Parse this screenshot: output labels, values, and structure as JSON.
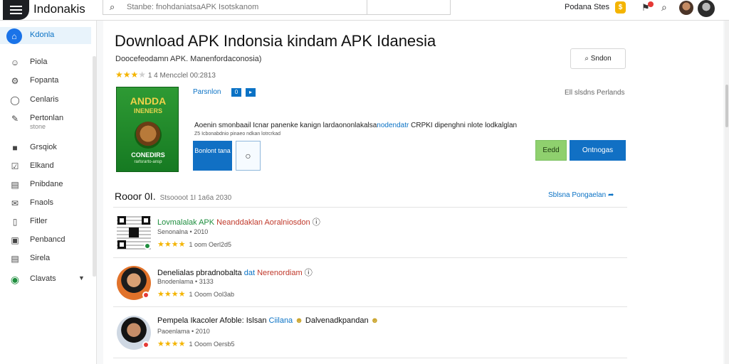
{
  "header": {
    "brand": "Indonakis",
    "search_placeholder": "Stanbe: fnohdaniatsaAPK Isotskanom",
    "user_label": "Podana Stes",
    "coin_label": "$",
    "icons": [
      "menu-icon",
      "search-icon",
      "notification-icon",
      "avatar"
    ]
  },
  "sidebar": {
    "items": [
      {
        "label": "Kdonla",
        "icon": "home-icon",
        "active": true
      },
      {
        "label": "Piola",
        "icon": "people-icon"
      },
      {
        "label": "Fopanta",
        "icon": "puzzle-icon"
      },
      {
        "label": "Cenlaris",
        "icon": "globe-icon"
      },
      {
        "label": "Pertonlan",
        "sub": "stone",
        "icon": "pen-icon"
      },
      {
        "label": "Grsqiok",
        "icon": "briefcase-icon"
      },
      {
        "label": "Elkand",
        "icon": "checkbox-icon"
      },
      {
        "label": "Pnibdane",
        "icon": "folder-icon"
      },
      {
        "label": "Fnaols",
        "icon": "mail-icon"
      },
      {
        "label": "Fitler",
        "icon": "chart-icon"
      },
      {
        "label": "Penbancd",
        "icon": "window-icon"
      },
      {
        "label": "Sirela",
        "icon": "document-icon"
      },
      {
        "label": "Clavats",
        "icon": "green-circle-icon"
      }
    ]
  },
  "main": {
    "title": "Download APK Indonsia kindam APK Idanesia",
    "subtitle": "Doocefeodamn APK. Manenfordaconosia)",
    "rating_text": "1 4 Mencclel 00:2813",
    "stars": 3,
    "top_button": "Sndon",
    "app": {
      "icon_line1": "ANDDA",
      "icon_line2": "INENERS",
      "icon_line3": "CONEDIRS",
      "icon_line4": "rarlsrarto-ansp",
      "developer": "Parsnlon",
      "meta_right": "Ell slsdns Perlands",
      "description_before": "Aoenin smonbaail Icnar panenke kanign lardaononlakalsa",
      "description_highlight": "nodendatr",
      "description_after": " CRPKI dipenghni nlote lodkalglan",
      "description_small": "Z5 Icbonabdnio pinaeo ndkan lotrcrkad",
      "btn_primary": "Bonlont tana",
      "btn_green": "Eedd",
      "btn_download": "Ontnogas"
    },
    "section": {
      "title": "Rooor 0I.",
      "subtitle": "Stsoooot 1I 1a6a 2030",
      "link": "Sblsna Pongaelan"
    },
    "rows": [
      {
        "title_a": "Lovmalalak APK",
        "title_b": "Neanddaklan Aoralniosdon",
        "sub": "Senonalna • 2010",
        "rating": "1 oom Oerl2d5",
        "stars": 4
      },
      {
        "title_a": "Denelialas pbradnobalta",
        "title_b": "dat",
        "title_c": "Nerenordiam",
        "sub": "Bnodenlama • 3133",
        "rating": "1 Ooom Ool3ab",
        "stars": 4
      },
      {
        "title_a": "Pempela Ikacoler Afoble: Islsan",
        "title_b": "Ciilana",
        "title_c": "Dalvenadkpandan",
        "sub": "Paoenlama • 2010",
        "rating": "1 Ooom Oersb5",
        "stars": 4
      }
    ]
  }
}
